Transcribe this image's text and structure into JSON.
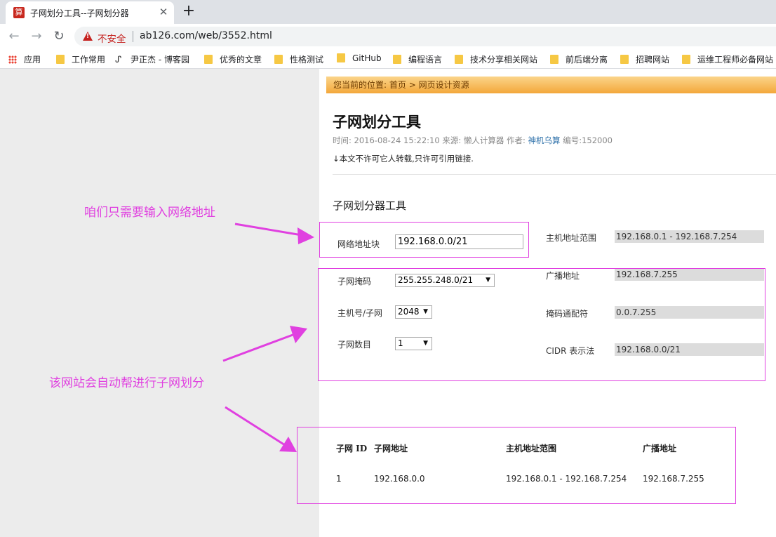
{
  "browser": {
    "tab": {
      "favicon_text": "算",
      "title": "子网划分工具--子网划分器",
      "close_glyph": "✕"
    },
    "new_tab_glyph": "+",
    "nav": {
      "back": "←",
      "forward": "→",
      "reload": "↻"
    },
    "address": {
      "security_label": "不安全",
      "url": "ab126.com/web/3552.html"
    },
    "bookmarks": [
      "应用",
      "工作常用",
      "尹正杰 - 博客园",
      "优秀的文章",
      "性格测试",
      "GitHub",
      "编程语言",
      "技术分享相关网站",
      "前后端分离",
      "招聘网站",
      "运维工程师必备网站"
    ]
  },
  "page": {
    "breadcrumb": {
      "prefix": "您当前的位置:",
      "home": "首页",
      "sep": ">",
      "section": "网页设计资源"
    },
    "title": "子网划分工具",
    "meta": {
      "time": "时间: 2016-08-24 15:22:10",
      "source": "来源: 懒人计算器",
      "author_label": "作者:",
      "author": "神机乌算",
      "number": "编号:152000"
    },
    "notice": "↓本文不许可它人转载,只许可引用链接.",
    "tool_heading": "子网划分器工具",
    "form": {
      "network_label": "网络地址块",
      "network_value": "192.168.0.0/21",
      "mask_label": "子网掩码",
      "mask_value": "255.255.248.0/21",
      "hosts_label": "主机号/子网",
      "hosts_value": "2048",
      "subnets_label": "子网数目",
      "subnets_value": "1",
      "select_arrow": "▼"
    },
    "results": {
      "host_range_label": "主机地址范围",
      "host_range_value": "192.168.0.1  -  192.168.7.254",
      "broadcast_label": "广播地址",
      "broadcast_value": "192.168.7.255",
      "wildcard_label": "掩码通配符",
      "wildcard_value": "0.0.7.255",
      "cidr_label": "CIDR 表示法",
      "cidr_value": "192.168.0.0/21"
    },
    "table": {
      "headers": [
        "子网 ID",
        "子网地址",
        "主机地址范围",
        "广播地址"
      ],
      "rows": [
        [
          "1",
          "192.168.0.0",
          "192.168.0.1 - 192.168.7.254",
          "192.168.7.255"
        ]
      ]
    }
  },
  "annotations": {
    "note_input": "咱们只需要输入网络地址",
    "note_auto": "该网站会自动帮进行子网划分",
    "color": "#e040e0"
  },
  "colors": {
    "tabstrip": "#dee1e6",
    "gutter": "#ececec",
    "breadcrumb_bar": "#f3a73a",
    "insecure": "#c5221f",
    "output_bg": "#dcdcdc"
  }
}
